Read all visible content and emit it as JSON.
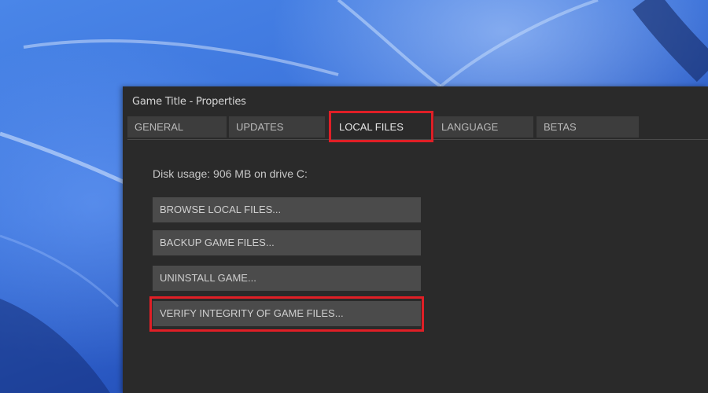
{
  "window": {
    "title": "Game Title - Properties"
  },
  "tabs": [
    {
      "label": "GENERAL",
      "active": false
    },
    {
      "label": "UPDATES",
      "active": false
    },
    {
      "label": "LOCAL FILES",
      "active": true
    },
    {
      "label": "LANGUAGE",
      "active": false
    },
    {
      "label": "BETAS",
      "active": false
    }
  ],
  "local_files": {
    "disk_usage": "Disk usage: 906 MB on drive C:",
    "buttons": [
      {
        "label": "BROWSE LOCAL FILES..."
      },
      {
        "label": "BACKUP GAME FILES..."
      },
      {
        "label": "UNINSTALL GAME..."
      },
      {
        "label": "VERIFY INTEGRITY OF GAME FILES..."
      }
    ]
  },
  "colors": {
    "window_bg": "#2a2a2a",
    "tab_bg": "#3d3d3d",
    "button_bg": "#4b4b4b",
    "highlight": "#e01f26",
    "desktop_blue": "#3c74dc"
  }
}
